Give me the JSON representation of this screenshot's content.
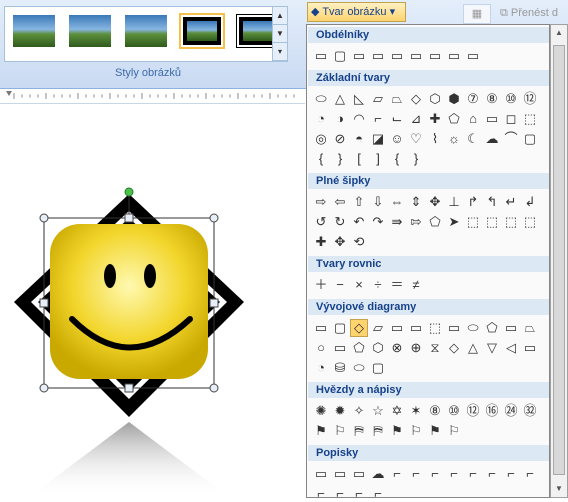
{
  "ribbon": {
    "gallery_label": "Styly obrázků",
    "shape_button_label": "Tvar obrázku",
    "send_back_label": "Přenést d"
  },
  "panel": {
    "sections": [
      {
        "title": "Obdélníky",
        "rows": [
          [
            "▭",
            "▢",
            "▭",
            "▭",
            "▭",
            "▭",
            "▭",
            "▭",
            "▭"
          ]
        ]
      },
      {
        "title": "Základní tvary",
        "rows": [
          [
            "⬭",
            "△",
            "◺",
            "▱",
            "⏢",
            "◇",
            "⬡",
            "⬢",
            "⑦",
            "⑧",
            "⑩",
            "⑫"
          ],
          [
            "◔",
            "◑",
            "◠",
            "⌐",
            "⌙",
            "⊿",
            "✚",
            "⬠",
            "⌂",
            "▭",
            "◻",
            "⬚"
          ],
          [
            "◎",
            "⊘",
            "◓",
            "◪",
            "☺",
            "♡",
            "⌇",
            "☼",
            "☾",
            "☁",
            "⌒",
            "▢"
          ],
          [
            "{",
            "}",
            "[",
            "]",
            "{",
            "}"
          ]
        ]
      },
      {
        "title": "Plné šipky",
        "rows": [
          [
            "⇨",
            "⇦",
            "⇧",
            "⇩",
            "⇔",
            "⇕",
            "✥",
            "⊥",
            "↱",
            "↰",
            "↵",
            "↲"
          ],
          [
            "↺",
            "↻",
            "↶",
            "↷",
            "⇛",
            "⇰",
            "⬠",
            "➤",
            "⬚",
            "⬚",
            "⬚",
            "⬚"
          ],
          [
            "✚",
            "✥",
            "⟲"
          ]
        ]
      },
      {
        "title": "Tvary rovnic",
        "rows": [
          [
            "＋",
            "−",
            "×",
            "÷",
            "＝",
            "≠"
          ]
        ]
      },
      {
        "title": "Vývojové diagramy",
        "rows": [
          [
            "▭",
            "▢",
            "◇",
            "▱",
            "▭",
            "▭",
            "⬚",
            "▭",
            "⬭",
            "⬠",
            "▭",
            "⏢"
          ],
          [
            "○",
            "▭",
            "⬠",
            "⬡",
            "⊗",
            "⊕",
            "⧖",
            "◇",
            "△",
            "▽",
            "◁",
            "▭"
          ],
          [
            "◔",
            "⛁",
            "⬭",
            "▢"
          ]
        ]
      },
      {
        "title": "Hvězdy a nápisy",
        "rows": [
          [
            "✺",
            "✹",
            "✧",
            "☆",
            "✡",
            "✶",
            "⑧",
            "⑩",
            "⑫",
            "⑯",
            "㉔",
            "㉜"
          ],
          [
            "⚑",
            "⚐",
            "⛿",
            "⛿",
            "⚑",
            "⚐",
            "⚑",
            "⚐"
          ]
        ]
      },
      {
        "title": "Popisky",
        "rows": [
          [
            "▭",
            "▭",
            "▭",
            "☁",
            "⌐",
            "⌐",
            "⌐",
            "⌐",
            "⌐",
            "⌐",
            "⌐",
            "⌐"
          ],
          [
            "⌐",
            "⌐",
            "⌐",
            "⌐"
          ]
        ]
      }
    ]
  },
  "colors": {
    "ribbon": "#c9daf2",
    "accent": "#ffd36e",
    "smiley": "#f2d52a"
  }
}
